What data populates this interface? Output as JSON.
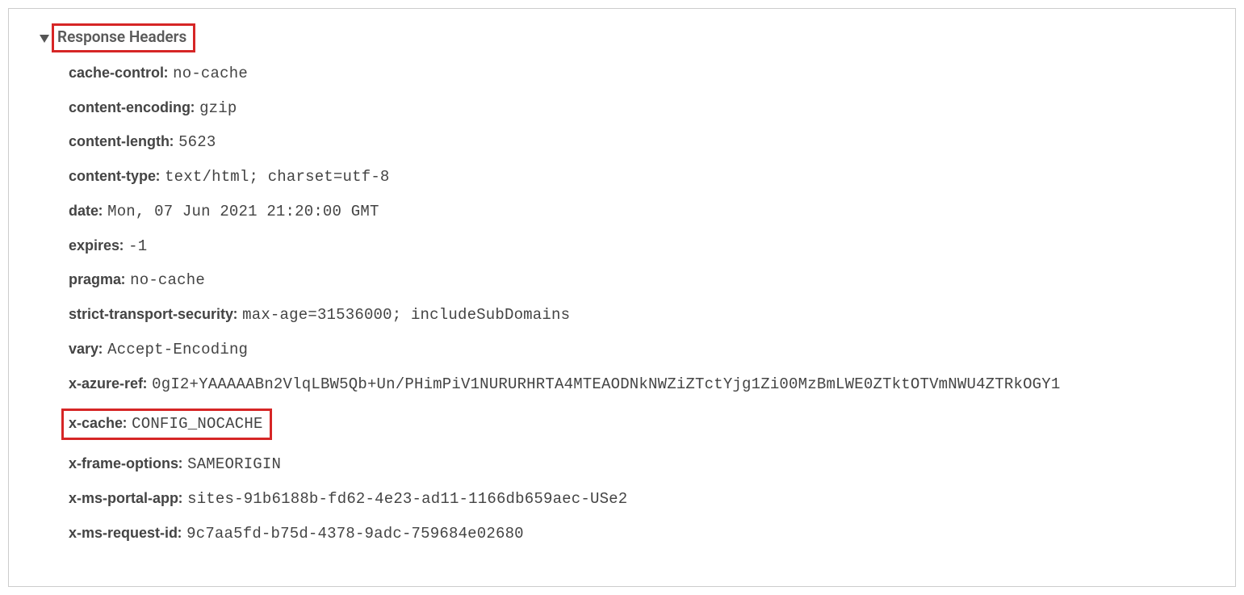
{
  "section": {
    "title": "Response Headers"
  },
  "headers": {
    "cache_control": {
      "key": "cache-control",
      "value": "no-cache"
    },
    "content_encoding": {
      "key": "content-encoding",
      "value": "gzip"
    },
    "content_length": {
      "key": "content-length",
      "value": "5623"
    },
    "content_type": {
      "key": "content-type",
      "value": "text/html; charset=utf-8"
    },
    "date": {
      "key": "date",
      "value": "Mon, 07 Jun 2021 21:20:00 GMT"
    },
    "expires": {
      "key": "expires",
      "value": "-1"
    },
    "pragma": {
      "key": "pragma",
      "value": "no-cache"
    },
    "sts": {
      "key": "strict-transport-security",
      "value": "max-age=31536000; includeSubDomains"
    },
    "vary": {
      "key": "vary",
      "value": "Accept-Encoding"
    },
    "x_azure_ref": {
      "key": "x-azure-ref",
      "value": "0gI2+YAAAAABn2VlqLBW5Qb+Un/PHimPiV1NURURHRTA4MTEAODNkNWZiZTctYjg1Zi00MzBmLWE0ZTktOTVmNWU4ZTRkOGY1"
    },
    "x_cache": {
      "key": "x-cache",
      "value": "CONFIG_NOCACHE"
    },
    "x_frame_options": {
      "key": "x-frame-options",
      "value": "SAMEORIGIN"
    },
    "x_ms_portal_app": {
      "key": "x-ms-portal-app",
      "value": "sites-91b6188b-fd62-4e23-ad11-1166db659aec-USe2"
    },
    "x_ms_request_id": {
      "key": "x-ms-request-id",
      "value": "9c7aa5fd-b75d-4378-9adc-759684e02680"
    }
  },
  "highlights": {
    "title_boxed": true,
    "x_cache_boxed": true
  }
}
